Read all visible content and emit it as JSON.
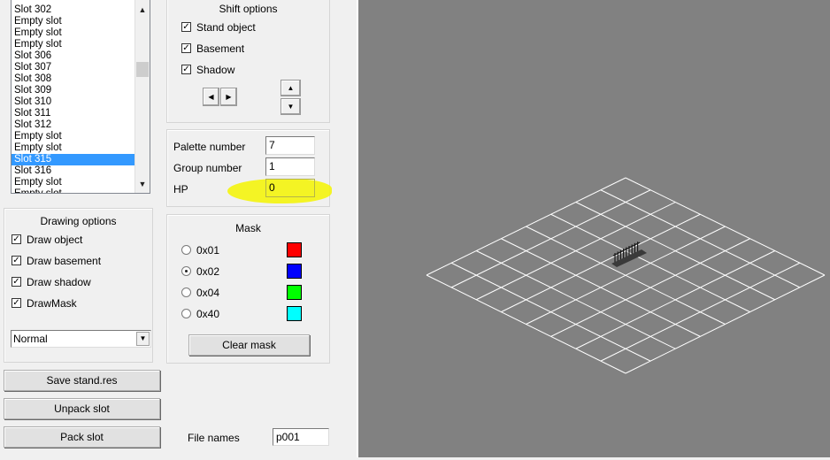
{
  "slot_list": {
    "items": [
      "Slot 302",
      "Empty slot",
      "Empty slot",
      "Empty slot",
      "Slot 306",
      "Slot 307",
      "Slot 308",
      "Slot 309",
      "Slot 310",
      "Slot 311",
      "Slot 312",
      "Empty slot",
      "Empty slot",
      "Slot 315",
      "Slot 316",
      "Empty slot",
      "Empty slot"
    ],
    "selected": "Slot 315"
  },
  "shift_options": {
    "title": "Shift options",
    "checks": [
      {
        "label": "Stand object",
        "checked": true
      },
      {
        "label": "Basement",
        "checked": true
      },
      {
        "label": "Shadow",
        "checked": true
      }
    ],
    "arrows": {
      "left": "◀",
      "right": "▶",
      "up": "▲",
      "down": "▼"
    }
  },
  "properties": {
    "palette_label": "Palette number",
    "palette_value": "7",
    "group_label": "Group number",
    "group_value": "1",
    "hp_label": "HP",
    "hp_value": "0",
    "highlight_color": "#f5f500"
  },
  "drawing_options": {
    "title": "Drawing options",
    "checks": [
      {
        "label": "Draw object",
        "checked": true
      },
      {
        "label": "Draw basement",
        "checked": true
      },
      {
        "label": "Draw shadow",
        "checked": true
      },
      {
        "label": "DrawMask",
        "checked": true
      }
    ],
    "mode_selected": "Normal",
    "dropdown_arrow": "▼"
  },
  "mask": {
    "title": "Mask",
    "options": [
      {
        "label": "0x01",
        "color": "#ff0000",
        "selected": false
      },
      {
        "label": "0x02",
        "color": "#0000ff",
        "selected": true
      },
      {
        "label": "0x04",
        "color": "#00ff00",
        "selected": false
      },
      {
        "label": "0x40",
        "color": "#00ffff",
        "selected": false
      }
    ],
    "clear_label": "Clear mask"
  },
  "actions": {
    "save_label": "Save stand.res",
    "unpack_label": "Unpack slot",
    "pack_label": "Pack slot"
  },
  "file_names": {
    "label": "File names",
    "value": "p001"
  },
  "viewport": {
    "background": "#818181",
    "grid_color": "#ffffff",
    "grid_cells": 8
  }
}
